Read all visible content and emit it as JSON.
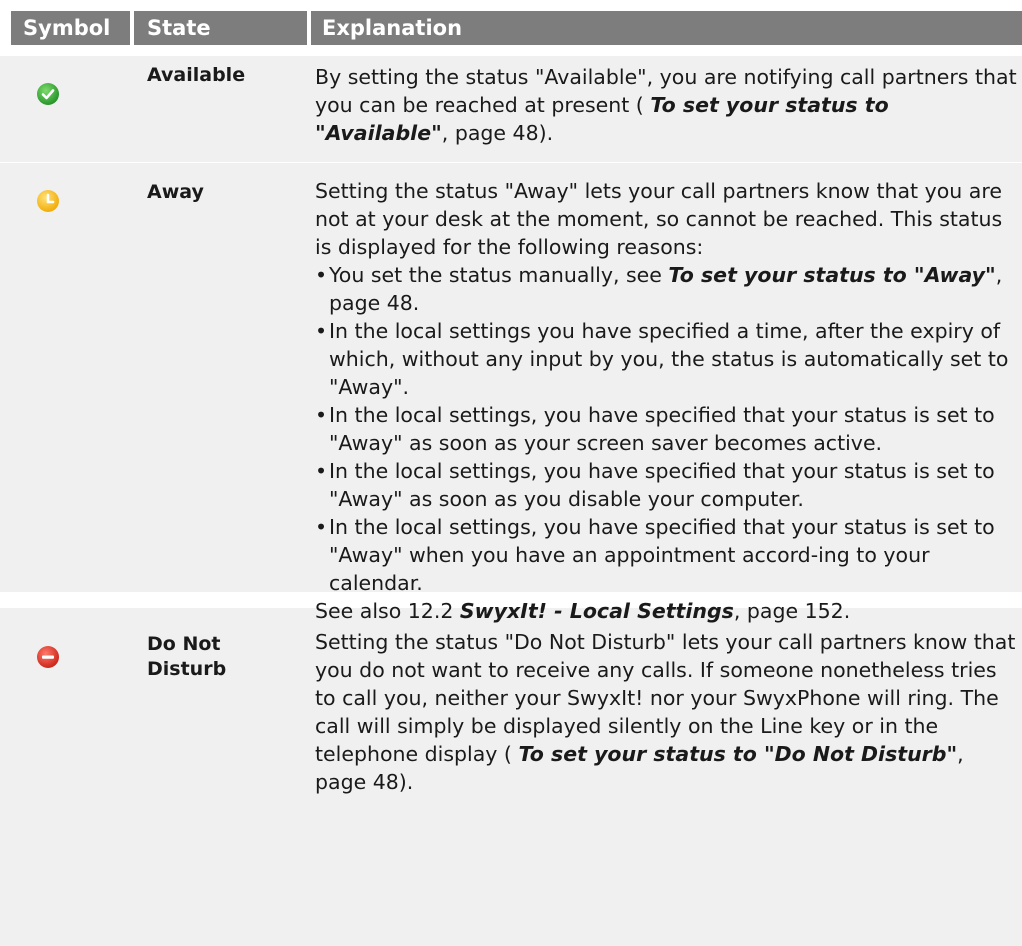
{
  "table": {
    "headers": {
      "symbol": "Symbol",
      "state": "State",
      "explanation": "Explanation"
    },
    "rows": [
      {
        "icon": "available-check-icon",
        "icon_color": "#2ea62e",
        "state": "Available",
        "text_1": "By setting the status \"Available\", you are notifying call partners that you can be reached at present (",
        "link_1": "To set your status to \"Available\"",
        "text_2": ", page 48)."
      },
      {
        "icon": "away-clock-icon",
        "icon_color": "#f5b800",
        "state": "Away",
        "intro": "Setting the status \"Away\" lets your call partners know that you are not at your desk at the moment, so cannot be reached. This status is displayed for the following reasons:",
        "bullet_1_text": "You set the status manually, see ",
        "bullet_1_link": "To set your status to \"Away\"",
        "bullet_1_tail": ", page 48.",
        "bullet_2": "In the local settings you have specified a time, after the expiry of which, without any input by you, the status is automatically set to \"Away\".",
        "bullet_3": "In the local settings, you have specified that your status is set to \"Away\" as soon as your screen saver becomes active.",
        "bullet_4": "In the local settings, you have specified that your status is set to \"Away\" as soon as you disable your computer.",
        "bullet_5": "In the local settings, you have specified that your status is set to \"Away\" when you have an appointment accord-ing to your calendar.",
        "see_also_text": "See also 12.2 ",
        "see_also_link": "SwyxIt! - Local Settings",
        "see_also_tail": ", page 152."
      },
      {
        "icon": "do-not-disturb-icon",
        "icon_color": "#e0312a",
        "state": "Do Not Disturb",
        "text_1": "Setting the status \"Do Not Disturb\" lets your call partners know that you do not want to receive any calls. If someone nonetheless tries to call you, neither your SwyxIt! nor your SwyxPhone will ring. The call will simply be displayed silently on the Line key or in the telephone display (",
        "link_1": "To set your status to \"Do Not Disturb\"",
        "text_2": ", page 48)."
      }
    ]
  }
}
